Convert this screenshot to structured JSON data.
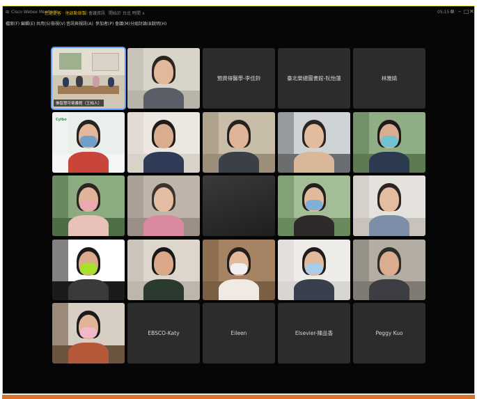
{
  "window": {
    "title": "Cisco Webex Meetings",
    "status_text": "您還是客 · 他啟動錄製",
    "meeting_info": "會議資訊",
    "time_text": "開始於 台北 時間 ∧",
    "clock": "05:15",
    "controls": [
      "⊗",
      "–",
      "□",
      "✕"
    ]
  },
  "menubar": {
    "items": [
      "檔案(F)",
      "編輯(E)",
      "共用(S)",
      "檢視(V)",
      "音訊與視訊(A)",
      "參加者(P)",
      "會議(M)",
      "分組討論(B)",
      "說明(H)"
    ]
  },
  "grid": {
    "tiles": [
      {
        "kind": "room",
        "label": "佛智慧可佬書館（王柏人）",
        "active": true
      },
      {
        "kind": "person",
        "bg": "#b9b4aa",
        "wall": "#d9d4c9",
        "skin": "#e2b89a",
        "hair": "#2a2522",
        "shirt": "#5a5e66",
        "mask": null
      },
      {
        "kind": "name",
        "name": "預資得醫學-李佳鈴"
      },
      {
        "kind": "name",
        "name": "臺北榮總圖書館-阮怡蓮"
      },
      {
        "kind": "name",
        "name": "林雅婧"
      },
      {
        "kind": "person",
        "bg": "#f3f6f4",
        "wall": "#e9f0ec",
        "skin": "#e3b79a",
        "hair": "#2a2220",
        "shirt": "#c9453a",
        "mask": "#6fa0c8",
        "logo": "Cylbo"
      },
      {
        "kind": "person",
        "bg": "#d9d2c8",
        "wall": "#ece7e0",
        "skin": "#d9ad8e",
        "hair": "#1e1b19",
        "shirt": "#2f3b57",
        "mask": null
      },
      {
        "kind": "person",
        "bg": "#9c8e78",
        "wall": "#c7bda9",
        "skin": "#e0b496",
        "hair": "#252220",
        "shirt": "#3a3f48",
        "mask": null
      },
      {
        "kind": "person",
        "bg": "#6b6e70",
        "wall": "#cfd3d6",
        "skin": "#e3bc9e",
        "hair": "#2a2523",
        "shirt": "#d9b89a",
        "mask": null
      },
      {
        "kind": "person",
        "bg": "#5d7a52",
        "wall": "#8fae86",
        "skin": "#d9ad8e",
        "hair": "#1d1b1a",
        "shirt": "#2b3a4e",
        "mask": "#6fc4d0"
      },
      {
        "kind": "person",
        "bg": "#4f6e46",
        "wall": "#8cab80",
        "skin": "#e0b496",
        "hair": "#2a2422",
        "shirt": "#e8c1b8",
        "mask": "#e9a8b4"
      },
      {
        "kind": "person",
        "bg": "#9b8f85",
        "wall": "#bfb4aa",
        "skin": "#e4bda2",
        "hair": "#3b332e",
        "shirt": "#d98aa0",
        "mask": null
      },
      {
        "kind": "dark"
      },
      {
        "kind": "person",
        "bg": "#6a8a5e",
        "wall": "#a3bd96",
        "skin": "#e3b99b",
        "hair": "#221f1d",
        "shirt": "#2e2a2a",
        "mask": "#7fb0d8"
      },
      {
        "kind": "person",
        "bg": "#c8c2bb",
        "wall": "#e5e1dc",
        "skin": "#e4bda0",
        "hair": "#2b2624",
        "shirt": "#7d8fa8",
        "mask": null
      },
      {
        "kind": "person",
        "bg": "#1b1b1b",
        "wall": "#ffffff",
        "skin": "#d8ab8c",
        "hair": "#1c1a19",
        "shirt": "#3a3a3a",
        "mask": "#a8e02a"
      },
      {
        "kind": "person",
        "bg": "#bdb6ac",
        "wall": "#dcd6cc",
        "skin": "#d9a888",
        "hair": "#181716",
        "shirt": "#2a3a2f",
        "mask": null
      },
      {
        "kind": "person",
        "bg": "#7b5f45",
        "wall": "#a68463",
        "skin": "#e3b99b",
        "hair": "#231f1d",
        "shirt": "#f1e9e3",
        "mask": "#f0f0f2"
      },
      {
        "kind": "person",
        "bg": "#d8d6d2",
        "wall": "#eeece9",
        "skin": "#e3b99b",
        "hair": "#1f1c1b",
        "shirt": "#3a3f4e",
        "mask": "#a9cde8"
      },
      {
        "kind": "person",
        "bg": "#807b72",
        "wall": "#b3ada3",
        "skin": "#d9ad8e",
        "hair": "#2e2b29",
        "shirt": "#3c3e44",
        "mask": null
      },
      {
        "kind": "person",
        "bg": "#6b5440",
        "wall": "#d7cfc4",
        "skin": "#e0b496",
        "hair": "#1d1a19",
        "shirt": "#b45a3a",
        "mask": "#f0b8c8"
      },
      {
        "kind": "name",
        "name": "EBSCO-Katy"
      },
      {
        "kind": "name",
        "name": "Eileen"
      },
      {
        "kind": "name",
        "name": "Elsevier-陳品香"
      },
      {
        "kind": "name",
        "name": "Peggy Kuo"
      }
    ]
  }
}
